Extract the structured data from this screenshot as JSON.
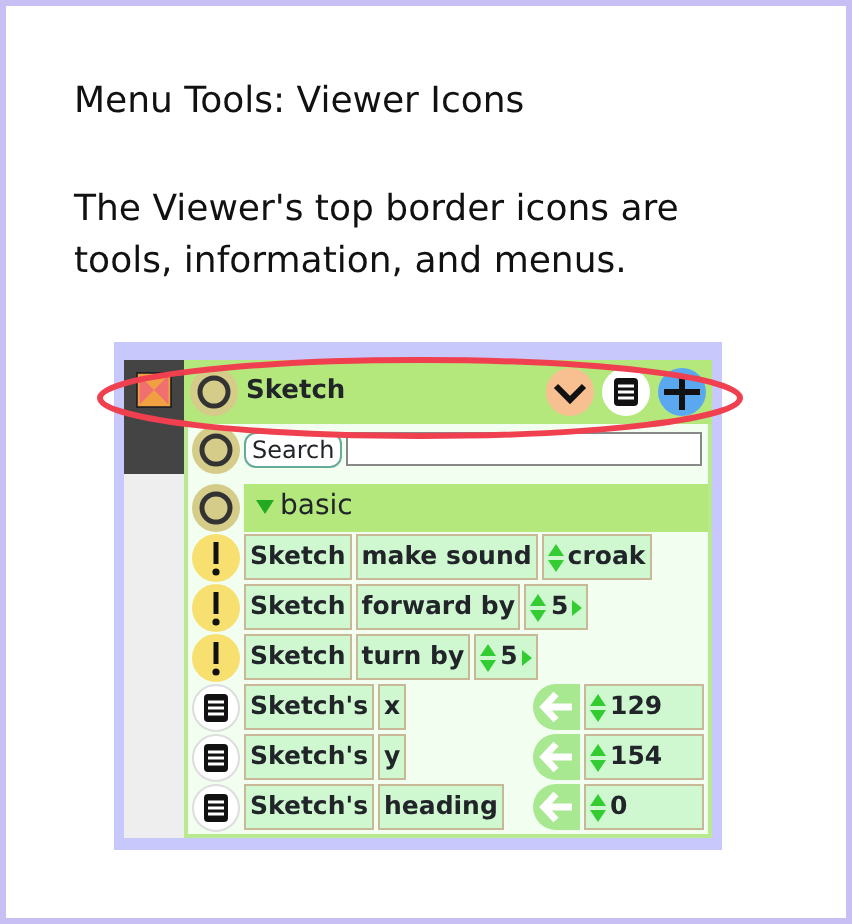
{
  "caption": {
    "title": "Menu Tools: Viewer Icons",
    "body": "The Viewer's top border icons are tools, information, and menus."
  },
  "viewer": {
    "title": "Sketch",
    "search_placeholder": "Search",
    "category": "basic",
    "category_expanded": true,
    "tiles": [
      {
        "kind": "command",
        "object": "Sketch",
        "label": "make sound",
        "argument": "croak",
        "step_arrow": false
      },
      {
        "kind": "command",
        "object": "Sketch",
        "label": "forward by",
        "argument": "5",
        "step_arrow": true
      },
      {
        "kind": "command",
        "object": "Sketch",
        "label": "turn by",
        "argument": "5",
        "step_arrow": true
      },
      {
        "kind": "getter",
        "object": "Sketch's",
        "label": "x",
        "value": "129"
      },
      {
        "kind": "getter",
        "object": "Sketch's",
        "label": "y",
        "value": "154"
      },
      {
        "kind": "getter",
        "object": "Sketch's",
        "label": "heading",
        "value": "0"
      }
    ]
  }
}
